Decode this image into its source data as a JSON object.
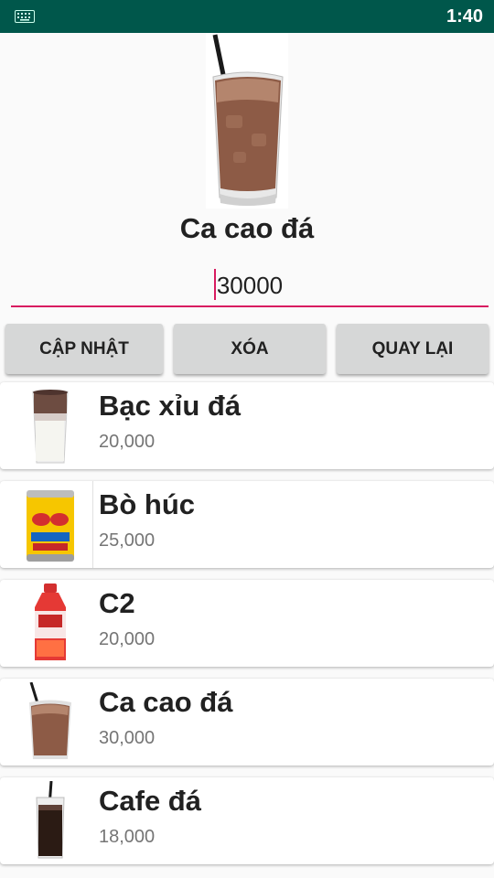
{
  "status_bar": {
    "time": "1:40",
    "keyboard_icon": "keyboard-icon"
  },
  "detail": {
    "name": "Ca cao đá",
    "price_value": "30000",
    "image_icon": "iced-cocoa-image"
  },
  "buttons": {
    "update_label": "CẬP NHẬT",
    "delete_label": "XÓA",
    "back_label": "QUAY LẠI"
  },
  "items": [
    {
      "name": "Bạc xỉu đá",
      "price": "20,000",
      "image": "bac-xiu-image"
    },
    {
      "name": "Bò húc",
      "price": "25,000",
      "image": "red-bull-can-image"
    },
    {
      "name": "C2",
      "price": "20,000",
      "image": "c2-bottle-image"
    },
    {
      "name": "Ca cao đá",
      "price": "30,000",
      "image": "iced-cocoa-image"
    },
    {
      "name": "Cafe đá",
      "price": "18,000",
      "image": "iced-coffee-image"
    }
  ],
  "colors": {
    "status_bar": "#00574B",
    "accent": "#D81B60",
    "button": "#D6D7D7"
  }
}
